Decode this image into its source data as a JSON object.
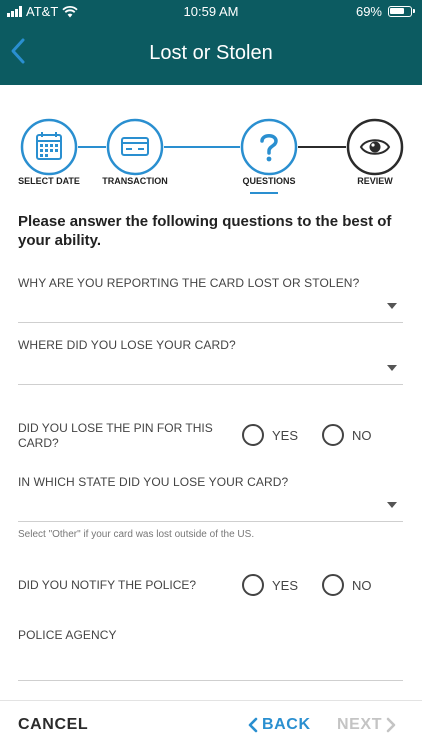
{
  "status": {
    "carrier": "AT&T",
    "time": "10:59 AM",
    "battery": "69%"
  },
  "header": {
    "title": "Lost or Stolen",
    "back_icon": "chevron-left-icon"
  },
  "stepper": {
    "steps": [
      {
        "label": "SELECT DATE",
        "icon": "calendar-icon",
        "state": "done"
      },
      {
        "label": "TRANSACTION",
        "icon": "credit-card-icon",
        "state": "done"
      },
      {
        "label": "QUESTIONS",
        "icon": "question-icon",
        "state": "active"
      },
      {
        "label": "REVIEW",
        "icon": "eye-icon",
        "state": "pending"
      }
    ],
    "colors": {
      "done": "#2a8fd0",
      "pending": "#2b2b2b"
    }
  },
  "intro": "Please answer the following questions to the best of your ability.",
  "questions": {
    "why": {
      "label": "WHY ARE YOU REPORTING THE CARD LOST OR STOLEN?",
      "value": ""
    },
    "where": {
      "label": "WHERE DID YOU LOSE YOUR CARD?",
      "value": ""
    },
    "pin": {
      "label": "DID YOU LOSE THE PIN FOR THIS CARD?",
      "yes": "YES",
      "no": "NO"
    },
    "state": {
      "label": "IN WHICH STATE DID YOU LOSE YOUR CARD?",
      "value": "",
      "helper": "Select \"Other\" if your card was lost outside of the US."
    },
    "police": {
      "label": "DID YOU NOTIFY THE POLICE?",
      "yes": "YES",
      "no": "NO"
    },
    "agency": {
      "label": "POLICE AGENCY",
      "value": ""
    }
  },
  "footer": {
    "cancel": "CANCEL",
    "back": "BACK",
    "next": "NEXT"
  },
  "colors": {
    "header_bg": "#0c5b61",
    "accent": "#2a8fd0",
    "disabled": "#c4c4c4"
  }
}
